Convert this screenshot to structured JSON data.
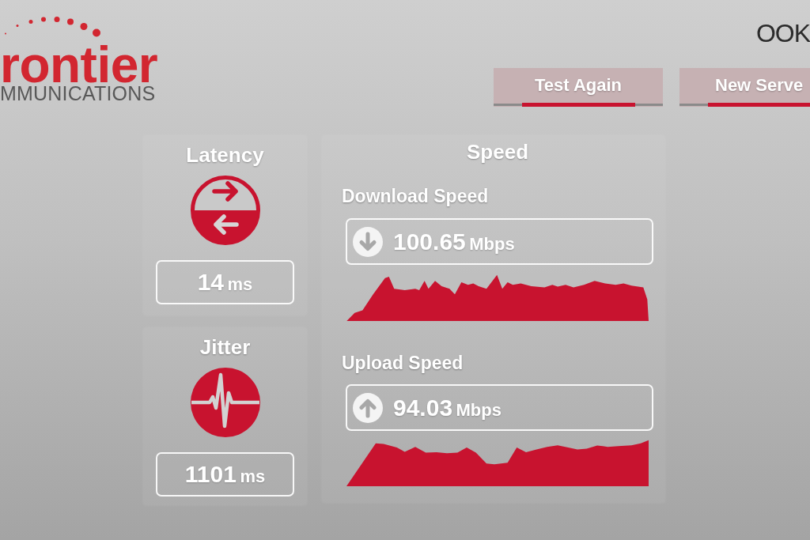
{
  "logo": {
    "wordmark": "rontier",
    "tagline": "MMUNICATIONS"
  },
  "partner_logo": {
    "text": "OOK"
  },
  "buttons": [
    {
      "label": "Test Again"
    },
    {
      "label": "New Serve"
    }
  ],
  "metrics": [
    {
      "kind": "latency",
      "title": "Latency",
      "value": "14",
      "unit": "ms"
    },
    {
      "kind": "jitter",
      "title": "Jitter",
      "value": "1101",
      "unit": "ms"
    }
  ],
  "speed": {
    "title": "Speed",
    "tests": [
      {
        "kind": "download",
        "label": "Download Speed",
        "value": "100.65",
        "unit": "Mbps"
      },
      {
        "kind": "upload",
        "label": "Upload Speed",
        "value": "94.03",
        "unit": "Mbps"
      }
    ]
  }
}
